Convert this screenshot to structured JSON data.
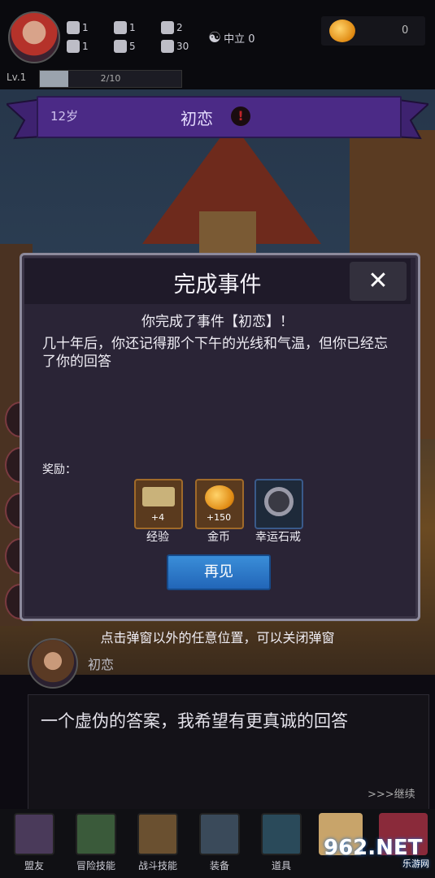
{
  "topbar": {
    "stats": [
      {
        "icon": "fist-icon",
        "value": "1"
      },
      {
        "icon": "arrow-icon",
        "value": "1"
      },
      {
        "icon": "hat-icon",
        "value": "2"
      },
      {
        "icon": "clover-icon",
        "value": "1"
      },
      {
        "icon": "book-icon",
        "value": "5"
      },
      {
        "icon": "sprout-icon",
        "value": "30"
      }
    ],
    "alignment": "中立 0",
    "level": "Lv.1",
    "xp_text": "2/10",
    "xp_fraction": 0.2,
    "gold": "0"
  },
  "event_banner": {
    "age": "12岁",
    "title": "初恋",
    "warn_symbol": "!"
  },
  "modal": {
    "title": "完成事件",
    "close_symbol": "✕",
    "subtitle": "你完成了事件【初恋】！",
    "text": "几十年后，你还记得那个下午的光线和气温，但你已经忘了你的回答",
    "rewards_label": "奖励：",
    "rewards": [
      {
        "icon": "exp-scroll-icon",
        "value": "+4",
        "name": "经验"
      },
      {
        "icon": "gold-coin-icon",
        "value": "+150",
        "name": "金币"
      },
      {
        "icon": "lucky-ring-icon",
        "value": "",
        "name": "幸运石戒"
      }
    ],
    "button": "再见"
  },
  "hint": "点击弹窗以外的任意位置，可以关闭弹窗",
  "dialogue": {
    "npc_name": "初恋",
    "text": "一个虚伪的答案，我希望有更真诚的回答",
    "continue": ">>>继续"
  },
  "nav": [
    {
      "icon": "handshake-icon",
      "label": "盟友"
    },
    {
      "icon": "adventure-icon",
      "label": "冒险技能"
    },
    {
      "icon": "backpack-icon",
      "label": "战斗技能"
    },
    {
      "icon": "swords-icon",
      "label": "装备"
    },
    {
      "icon": "potion-icon",
      "label": "道具"
    }
  ],
  "watermark": {
    "main": "962.NET",
    "sub": "乐游网"
  }
}
